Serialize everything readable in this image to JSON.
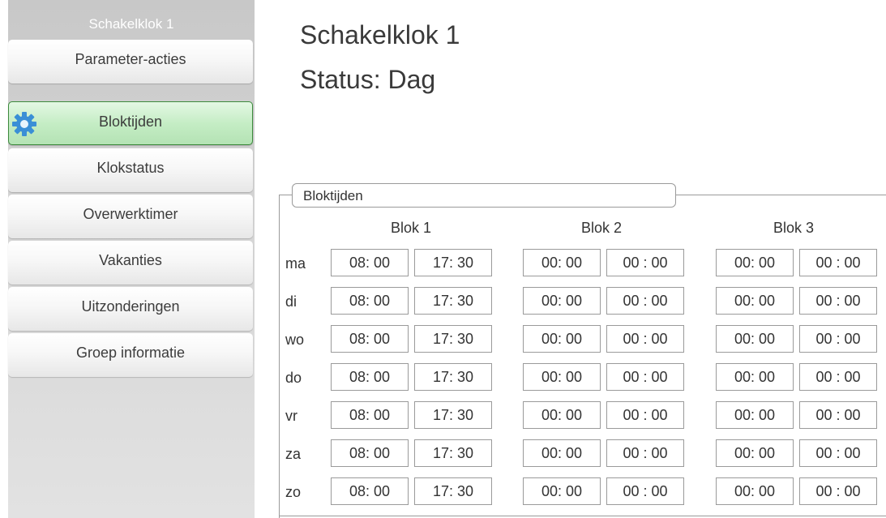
{
  "sidebar": {
    "title": "Schakelklok 1",
    "items": [
      {
        "label": "Parameter-acties",
        "active": false,
        "name": "parameter-acties"
      },
      {
        "label": "Bloktijden",
        "active": true,
        "name": "bloktijden"
      },
      {
        "label": "Klokstatus",
        "active": false,
        "name": "klokstatus"
      },
      {
        "label": "Overwerktimer",
        "active": false,
        "name": "overwerktimer"
      },
      {
        "label": "Vakanties",
        "active": false,
        "name": "vakanties"
      },
      {
        "label": "Uitzonderingen",
        "active": false,
        "name": "uitzonderingen"
      },
      {
        "label": "Groep informatie",
        "active": false,
        "name": "groep-informatie"
      }
    ],
    "active_icon": "gear-icon"
  },
  "header": {
    "title": "Schakelklok 1",
    "status": "Status: Dag"
  },
  "bloktijden": {
    "group_label": "Bloktijden",
    "blocks": [
      "Blok 1",
      "Blok 2",
      "Blok 3"
    ],
    "rows": [
      {
        "day": "ma",
        "times": [
          "08: 00",
          "17: 30",
          "00: 00",
          "00 : 00",
          "00: 00",
          "00 : 00"
        ]
      },
      {
        "day": "di",
        "times": [
          "08: 00",
          "17: 30",
          "00: 00",
          "00 : 00",
          "00: 00",
          "00 : 00"
        ]
      },
      {
        "day": "wo",
        "times": [
          "08: 00",
          "17: 30",
          "00: 00",
          "00 : 00",
          "00: 00",
          "00 : 00"
        ]
      },
      {
        "day": "do",
        "times": [
          "08: 00",
          "17: 30",
          "00: 00",
          "00 : 00",
          "00: 00",
          "00 : 00"
        ]
      },
      {
        "day": "vr",
        "times": [
          "08: 00",
          "17: 30",
          "00: 00",
          "00 : 00",
          "00: 00",
          "00 : 00"
        ]
      },
      {
        "day": "za",
        "times": [
          "08: 00",
          "17: 30",
          "00: 00",
          "00 : 00",
          "00: 00",
          "00 : 00"
        ]
      },
      {
        "day": "zo",
        "times": [
          "08: 00",
          "17: 30",
          "00: 00",
          "00 : 00",
          "00: 00",
          "00 : 00"
        ]
      }
    ]
  },
  "colors": {
    "active_item": "#c5edc5",
    "active_border": "#3c8a3c",
    "gear": "#3a8fd6",
    "sidebar": "#d0d0d0"
  }
}
